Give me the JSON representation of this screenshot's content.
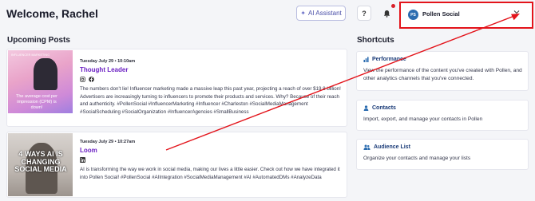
{
  "header": {
    "welcome": "Welcome, Rachel",
    "ai_button": "AI Assistant",
    "help_label": "?",
    "account": {
      "avatar_initials": "PS",
      "name": "Pollen Social"
    }
  },
  "upcoming": {
    "title": "Upcoming Posts",
    "posts": [
      {
        "date": "Tuesday July 29 • 10:10am",
        "title": "Thought Leader",
        "networks": [
          "instagram-icon",
          "facebook-icon"
        ],
        "thumb_tag": "INFLUENCER MARKETING",
        "thumb_caption": "The average cost per impression (CPM) is down!",
        "text": "The numbers don't lie! Influencer marketing made a massive leap this past year, projecting a reach of over $19.8 billion! Advertisers are increasingly turning to influencers to promote their products and services. Why? Because of their reach and authenticity. #PollenSocial #InfluencerMarketing #Influencer #Charleston #SocialMediaManagement #SocialScheduling #SocialOrganization #InfluencerAgencies #SmallBusiness"
      },
      {
        "date": "Tuesday July 29 • 10:27am",
        "title": "Loom",
        "networks": [
          "linkedin-icon"
        ],
        "thumb_caption": "4 WAYS AI IS CHANGING SOCIAL MEDIA",
        "text": "AI is transforming the way we work in social media, making our lives a little easier. Check out how we have integrated it into Pollen Social! #PollenSocial #AIIntegration #SocialMediaManagement #AI #AutomatedDMs #AnalyzeData"
      }
    ]
  },
  "shortcuts": {
    "title": "Shortcuts",
    "items": [
      {
        "title": "Performance",
        "icon": "bar-chart-icon",
        "desc": "View the performance of the content you've created with Pollen, and other analytics channels that you've connected."
      },
      {
        "title": "Contacts",
        "icon": "person-icon",
        "desc": "Import, export, and manage your contacts in Pollen"
      },
      {
        "title": "Audience List",
        "icon": "people-icon",
        "desc": "Organize your contacts and manage your lists"
      }
    ]
  },
  "colors": {
    "highlight_red": "#e3141b",
    "post_title": "#6a1fc2",
    "shortcut_title": "#1a3b78"
  }
}
